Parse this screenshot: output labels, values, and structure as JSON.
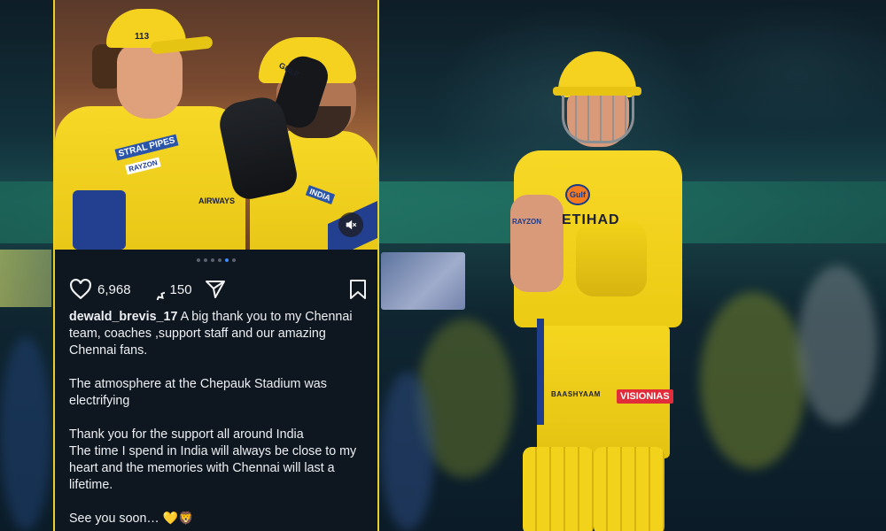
{
  "post": {
    "username": "dewald_brevis_17",
    "likes": "6,968",
    "comments": "150",
    "caption_lines": [
      "A big thank you to my Chennai team, coaches ,support staff and our amazing Chennai fans.",
      "",
      "The atmosphere at the Chepauk Stadium was electrifying",
      "",
      "Thank you for the support all around India",
      "The time I spend in India will always be close to my heart and the memories with Chennai will last a lifetime.",
      "",
      "See you soon…"
    ],
    "emojis": "💛🦁",
    "carousel": {
      "total": 6,
      "active": 5
    },
    "icons": {
      "like": "heart-icon",
      "comment": "comment-icon",
      "share": "send-icon",
      "save": "bookmark-icon",
      "mute": "speaker-muted-icon"
    }
  },
  "photo_text": {
    "cap_number": "113",
    "left_sponsor_1": "STRAL PIPES",
    "left_sponsor_2": "RAYZON",
    "left_airways": "AIRWAYS",
    "right_cap_logo": "GULF",
    "right_sponsor": "INDIA"
  },
  "player_sponsors": {
    "gulf": "Gulf",
    "etihad": "ETIHAD",
    "chest_side": "RAYZON",
    "shorts_left": "BAASHYAAM",
    "shorts_right": "VISIONIAS"
  },
  "colors": {
    "team_yellow": "#f4d21f",
    "card_background": "#0e1620",
    "card_border": "#e8cf2a",
    "carousel_active": "#3d8bff"
  }
}
